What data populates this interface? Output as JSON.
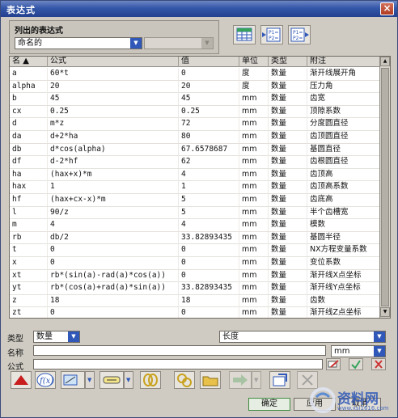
{
  "title": "表达式",
  "close_label": "×",
  "list_group": {
    "label": "列出的表达式",
    "filter_value": "命名的",
    "second_value": ""
  },
  "table": {
    "headers": [
      "名",
      "公式",
      "值",
      "单位",
      "类型",
      "附注"
    ],
    "rows": [
      [
        "a",
        "60*t",
        "0",
        "度",
        "数量",
        "渐开线展开角"
      ],
      [
        "alpha",
        "20",
        "20",
        "度",
        "数量",
        "压力角"
      ],
      [
        "b",
        "45",
        "45",
        "mm",
        "数量",
        "齿宽"
      ],
      [
        "cx",
        "0.25",
        "0.25",
        "mm",
        "数量",
        "顶隙系数"
      ],
      [
        "d",
        "m*z",
        "72",
        "mm",
        "数量",
        "分度圆直径"
      ],
      [
        "da",
        "d+2*ha",
        "80",
        "mm",
        "数量",
        "齿顶圆直径"
      ],
      [
        "db",
        "d*cos(alpha)",
        "67.6578687",
        "mm",
        "数量",
        "基圆直径"
      ],
      [
        "df",
        "d-2*hf",
        "62",
        "mm",
        "数量",
        "齿根圆直径"
      ],
      [
        "ha",
        "(hax+x)*m",
        "4",
        "mm",
        "数量",
        "齿顶高"
      ],
      [
        "hax",
        "1",
        "1",
        "mm",
        "数量",
        "齿顶高系数"
      ],
      [
        "hf",
        "(hax+cx-x)*m",
        "5",
        "mm",
        "数量",
        "齿底高"
      ],
      [
        "l",
        "90/z",
        "5",
        "mm",
        "数量",
        "半个齿槽宽"
      ],
      [
        "m",
        "4",
        "4",
        "mm",
        "数量",
        "模数"
      ],
      [
        "rb",
        "db/2",
        "33.82893435",
        "mm",
        "数量",
        "基圆半径"
      ],
      [
        "t",
        "0",
        "0",
        "mm",
        "数量",
        "NX方程变量系数"
      ],
      [
        "x",
        "0",
        "0",
        "mm",
        "数量",
        "变位系数"
      ],
      [
        "xt",
        "rb*(sin(a)-rad(a)*cos(a))",
        "0",
        "mm",
        "数量",
        "渐开线X点坐标"
      ],
      [
        "yt",
        "rb*(cos(a)+rad(a)*sin(a))",
        "33.82893435",
        "mm",
        "数量",
        "渐开线Y点坐标"
      ],
      [
        "z",
        "18",
        "18",
        "mm",
        "数量",
        "齿数"
      ],
      [
        "zt",
        "0",
        "0",
        "mm",
        "数量",
        "渐开线Z点坐标"
      ]
    ]
  },
  "type_row": {
    "label": "类型",
    "type_value": "数量",
    "dimension_value": "长度"
  },
  "name_row": {
    "label": "名称",
    "value": "",
    "unit_value": "mm"
  },
  "formula_row": {
    "label": "公式",
    "value": ""
  },
  "buttons": {
    "ok": "确定",
    "apply": "应用",
    "cancel": "取消"
  },
  "watermark": {
    "text": "资料网",
    "url": "www.xsi1616.com"
  },
  "colors": {
    "title_bar": "#23408e",
    "accent_blue": "#2f58b8",
    "selection": "#2f58b8"
  }
}
